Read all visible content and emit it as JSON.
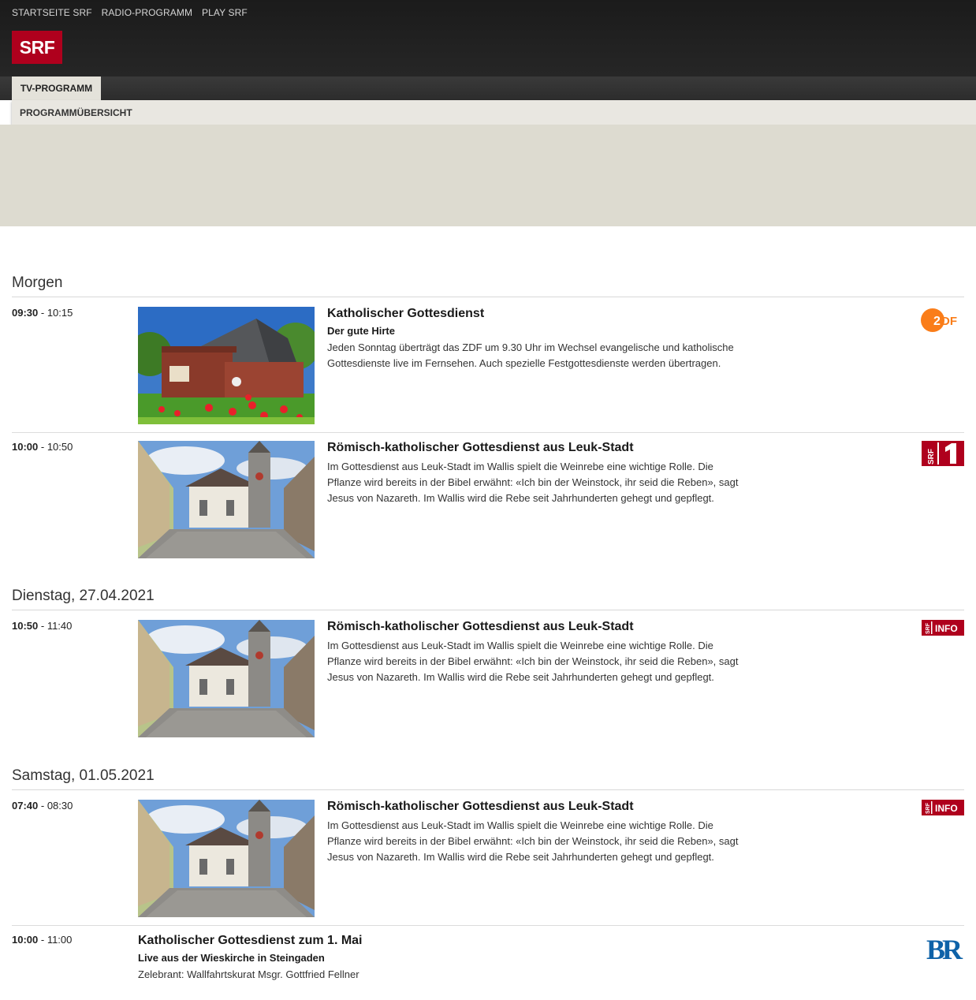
{
  "top_nav": [
    "STARTSEITE SRF",
    "RADIO-PROGRAMM",
    "PLAY SRF"
  ],
  "logo_text": "SRF",
  "tab_label": "TV-PROGRAMM",
  "subnav_label": "PROGRAMMÜBERSICHT",
  "days": [
    {
      "label": "Morgen",
      "items": [
        {
          "start": "09:30",
          "end": "10:15",
          "title": "Katholischer Gottesdienst",
          "subtitle": "Der gute Hirte",
          "description": "Jeden Sonntag überträgt das ZDF um 9.30 Uhr im Wechsel evangelische und katholische Gottesdienste live im Fernsehen. Auch spezielle Festgottesdienste werden übertragen.",
          "image": "church-modern",
          "channel": "ZDF"
        },
        {
          "start": "10:00",
          "end": "10:50",
          "title": "Römisch-katholischer Gottesdienst aus Leuk-Stadt",
          "subtitle": "",
          "description": "Im Gottesdienst aus Leuk-Stadt im Wallis spielt die Weinrebe eine wichtige Rolle. Die Pflanze wird bereits in der Bibel erwähnt: «Ich bin der Weinstock, ihr seid die Reben», sagt Jesus von Nazareth. Im Wallis wird die Rebe seit Jahrhunderten gehegt und gepflegt.",
          "image": "church-leuk",
          "channel": "SRF 1"
        }
      ]
    },
    {
      "label": "Dienstag, 27.04.2021",
      "items": [
        {
          "start": "10:50",
          "end": "11:40",
          "title": "Römisch-katholischer Gottesdienst aus Leuk-Stadt",
          "subtitle": "",
          "description": "Im Gottesdienst aus Leuk-Stadt im Wallis spielt die Weinrebe eine wichtige Rolle. Die Pflanze wird bereits in der Bibel erwähnt: «Ich bin der Weinstock, ihr seid die Reben», sagt Jesus von Nazareth. Im Wallis wird die Rebe seit Jahrhunderten gehegt und gepflegt.",
          "image": "church-leuk",
          "channel": "SRF info"
        }
      ]
    },
    {
      "label": "Samstag, 01.05.2021",
      "items": [
        {
          "start": "07:40",
          "end": "08:30",
          "title": "Römisch-katholischer Gottesdienst aus Leuk-Stadt",
          "subtitle": "",
          "description": "Im Gottesdienst aus Leuk-Stadt im Wallis spielt die Weinrebe eine wichtige Rolle. Die Pflanze wird bereits in der Bibel erwähnt: «Ich bin der Weinstock, ihr seid die Reben», sagt Jesus von Nazareth. Im Wallis wird die Rebe seit Jahrhunderten gehegt und gepflegt.",
          "image": "church-leuk",
          "channel": "SRF info"
        },
        {
          "start": "10:00",
          "end": "11:00",
          "title": "Katholischer Gottesdienst zum 1. Mai",
          "subtitle": "Live aus der Wieskirche in Steingaden",
          "description": "Zelebrant: Wallfahrtskurat Msgr. Gottfried Fellner",
          "image": "",
          "channel": "BR"
        }
      ]
    }
  ],
  "colors": {
    "srf_red": "#af001d",
    "zdf_orange": "#fa7d19",
    "br_blue": "#0e62a8"
  }
}
